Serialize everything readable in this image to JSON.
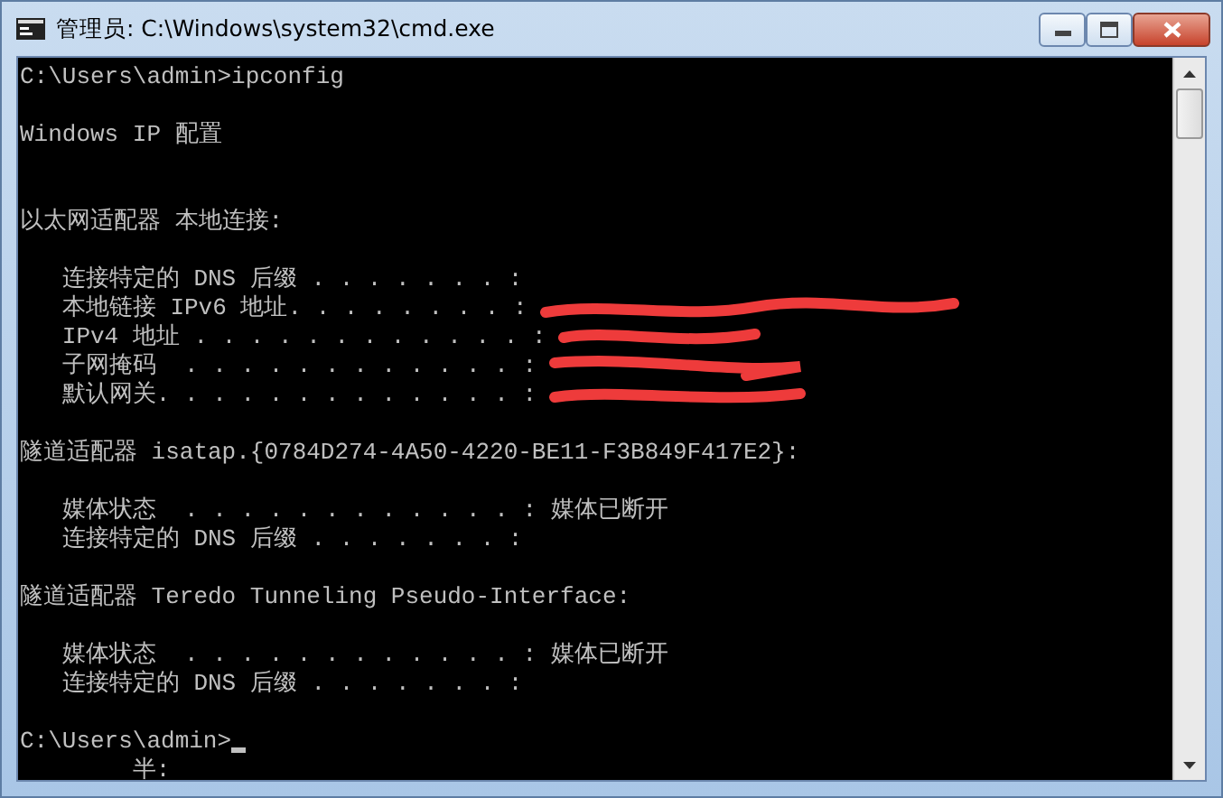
{
  "window": {
    "title": "管理员: C:\\Windows\\system32\\cmd.exe"
  },
  "console": {
    "lines": [
      {
        "kind": "text",
        "text": "C:\\Users\\admin>ipconfig"
      },
      {
        "kind": "blank"
      },
      {
        "kind": "text",
        "text": "Windows IP 配置"
      },
      {
        "kind": "blank"
      },
      {
        "kind": "blank"
      },
      {
        "kind": "text",
        "text": "以太网适配器 本地连接:"
      },
      {
        "kind": "blank"
      },
      {
        "kind": "text",
        "text": "   连接特定的 DNS 后缀 . . . . . . . :"
      },
      {
        "kind": "text",
        "text": "   本地链接 IPv6 地址. . . . . . . . :",
        "redacted": true
      },
      {
        "kind": "text",
        "text": "   IPv4 地址 . . . . . . . . . . . . :",
        "redacted": true
      },
      {
        "kind": "text",
        "text": "   子网掩码  . . . . . . . . . . . . :",
        "redacted": true
      },
      {
        "kind": "text",
        "text": "   默认网关. . . . . . . . . . . . . :",
        "redacted": true
      },
      {
        "kind": "blank"
      },
      {
        "kind": "text",
        "text": "隧道适配器 isatap.{0784D274-4A50-4220-BE11-F3B849F417E2}:"
      },
      {
        "kind": "blank"
      },
      {
        "kind": "text",
        "text": "   媒体状态  . . . . . . . . . . . . : 媒体已断开"
      },
      {
        "kind": "text",
        "text": "   连接特定的 DNS 后缀 . . . . . . . :"
      },
      {
        "kind": "blank"
      },
      {
        "kind": "text",
        "text": "隧道适配器 Teredo Tunneling Pseudo-Interface:"
      },
      {
        "kind": "blank"
      },
      {
        "kind": "text",
        "text": "   媒体状态  . . . . . . . . . . . . : 媒体已断开"
      },
      {
        "kind": "text",
        "text": "   连接特定的 DNS 后缀 . . . . . . . :"
      },
      {
        "kind": "blank"
      },
      {
        "kind": "text",
        "text": "C:\\Users\\admin>",
        "cursor": true
      },
      {
        "kind": "text",
        "text": "        半:"
      }
    ]
  }
}
